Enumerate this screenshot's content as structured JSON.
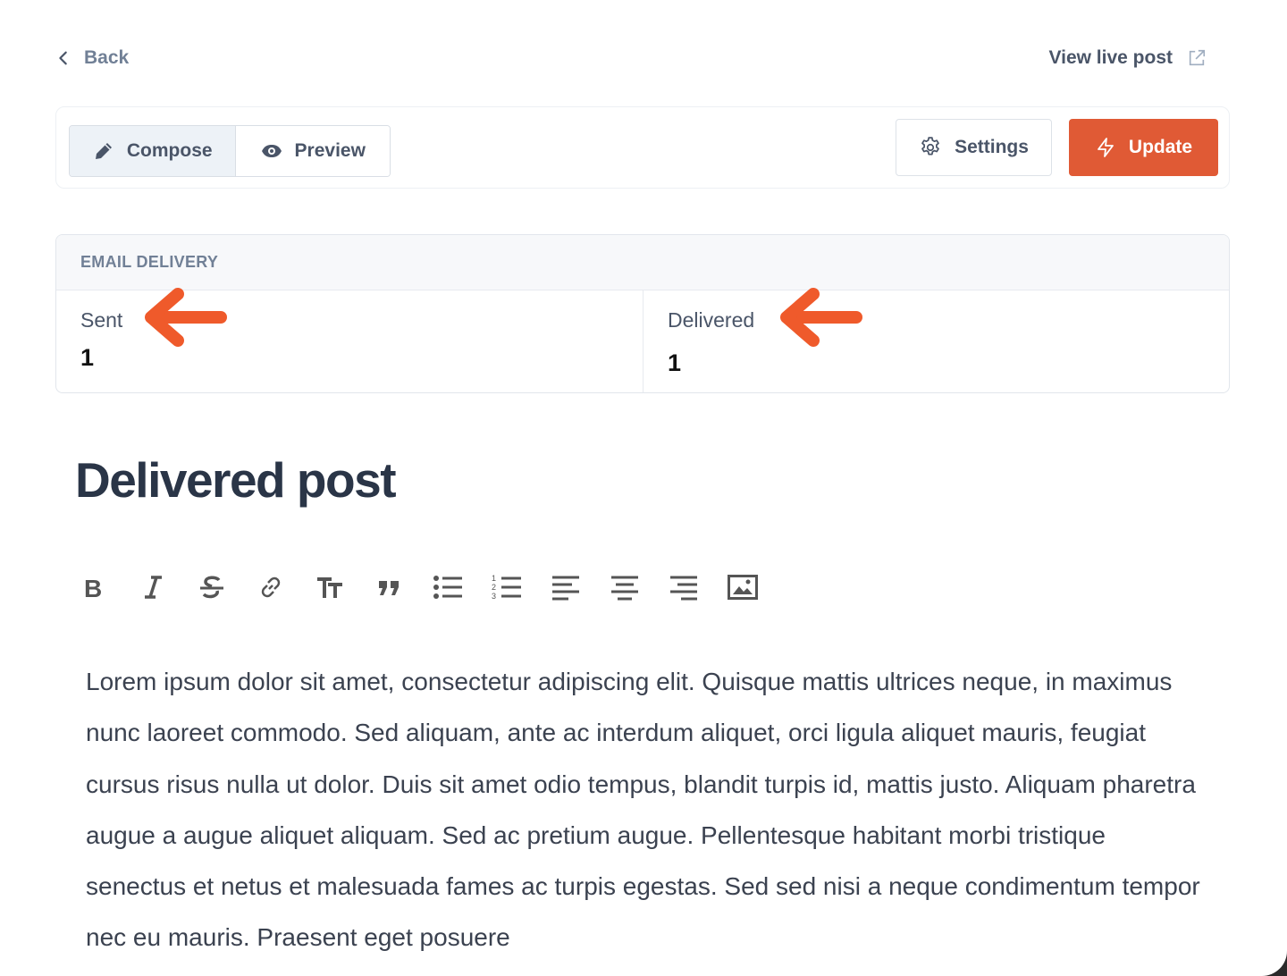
{
  "nav": {
    "back_label": "Back",
    "view_live_label": "View live post"
  },
  "toolbar": {
    "compose_label": "Compose",
    "preview_label": "Preview",
    "settings_label": "Settings",
    "update_label": "Update"
  },
  "email_delivery": {
    "heading": "EMAIL DELIVERY",
    "sent_label": "Sent",
    "sent_value": "1",
    "delivered_label": "Delivered",
    "delivered_value": "1"
  },
  "post": {
    "title": "Delivered post",
    "body": "Lorem ipsum dolor sit amet, consectetur adipiscing elit. Quisque mattis ultrices neque, in maximus nunc laoreet commodo. Sed aliquam, ante ac interdum aliquet, orci ligula aliquet mauris, feugiat cursus risus nulla ut dolor. Duis sit amet odio tempus, blandit turpis id, mattis justo. Aliquam pharetra augue a augue aliquet aliquam. Sed ac pretium augue. Pellentesque habitant morbi tristique senectus et netus et malesuada fames ac turpis egestas. Sed sed nisi a neque condimentum tempor nec eu mauris. Praesent eget posuere"
  },
  "format_toolbar": [
    "bold-icon",
    "italic-icon",
    "strikethrough-icon",
    "link-icon",
    "text-size-icon",
    "quote-icon",
    "bullet-list-icon",
    "numbered-list-icon",
    "align-left-icon",
    "align-center-icon",
    "align-right-icon",
    "image-icon"
  ],
  "colors": {
    "accent": "#e05a35",
    "annotation_arrow": "#ef5a2b"
  }
}
